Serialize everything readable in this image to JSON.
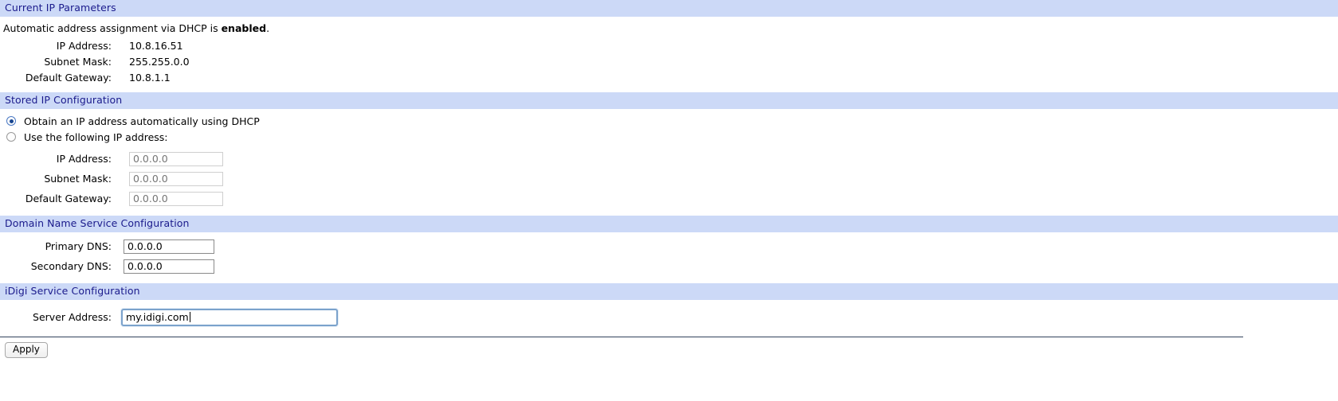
{
  "sections": {
    "current_ip": {
      "header": "Current IP Parameters",
      "intro_prefix": "Automatic address assignment via DHCP is ",
      "intro_status": "enabled",
      "intro_suffix": ".",
      "rows": [
        {
          "label": "IP Address:",
          "value": "10.8.16.51"
        },
        {
          "label": "Subnet Mask:",
          "value": "255.255.0.0"
        },
        {
          "label": "Default Gateway:",
          "value": "10.8.1.1"
        }
      ]
    },
    "stored_ip": {
      "header": "Stored IP Configuration",
      "radios": [
        {
          "label": "Obtain an IP address automatically using DHCP",
          "selected": true
        },
        {
          "label": "Use the following IP address:",
          "selected": false
        }
      ],
      "fields": [
        {
          "label": "IP Address:",
          "value": "",
          "placeholder": "0.0.0.0"
        },
        {
          "label": "Subnet Mask:",
          "value": "",
          "placeholder": "0.0.0.0"
        },
        {
          "label": "Default Gateway:",
          "value": "",
          "placeholder": "0.0.0.0"
        }
      ]
    },
    "dns": {
      "header": "Domain Name Service Configuration",
      "fields": [
        {
          "label": "Primary DNS:",
          "value": "0.0.0.0"
        },
        {
          "label": "Secondary DNS:",
          "value": "0.0.0.0"
        }
      ]
    },
    "idigi": {
      "header": "iDigi Service Configuration",
      "field": {
        "label": "Server Address:",
        "value": "my.idigi.com"
      }
    }
  },
  "footer": {
    "apply_label": "Apply"
  },
  "colors": {
    "section_header_bg": "#ccd9f7",
    "section_header_text": "#1a1a8c",
    "focus_border": "#7ba2cc",
    "radio_dot": "#17458f"
  }
}
